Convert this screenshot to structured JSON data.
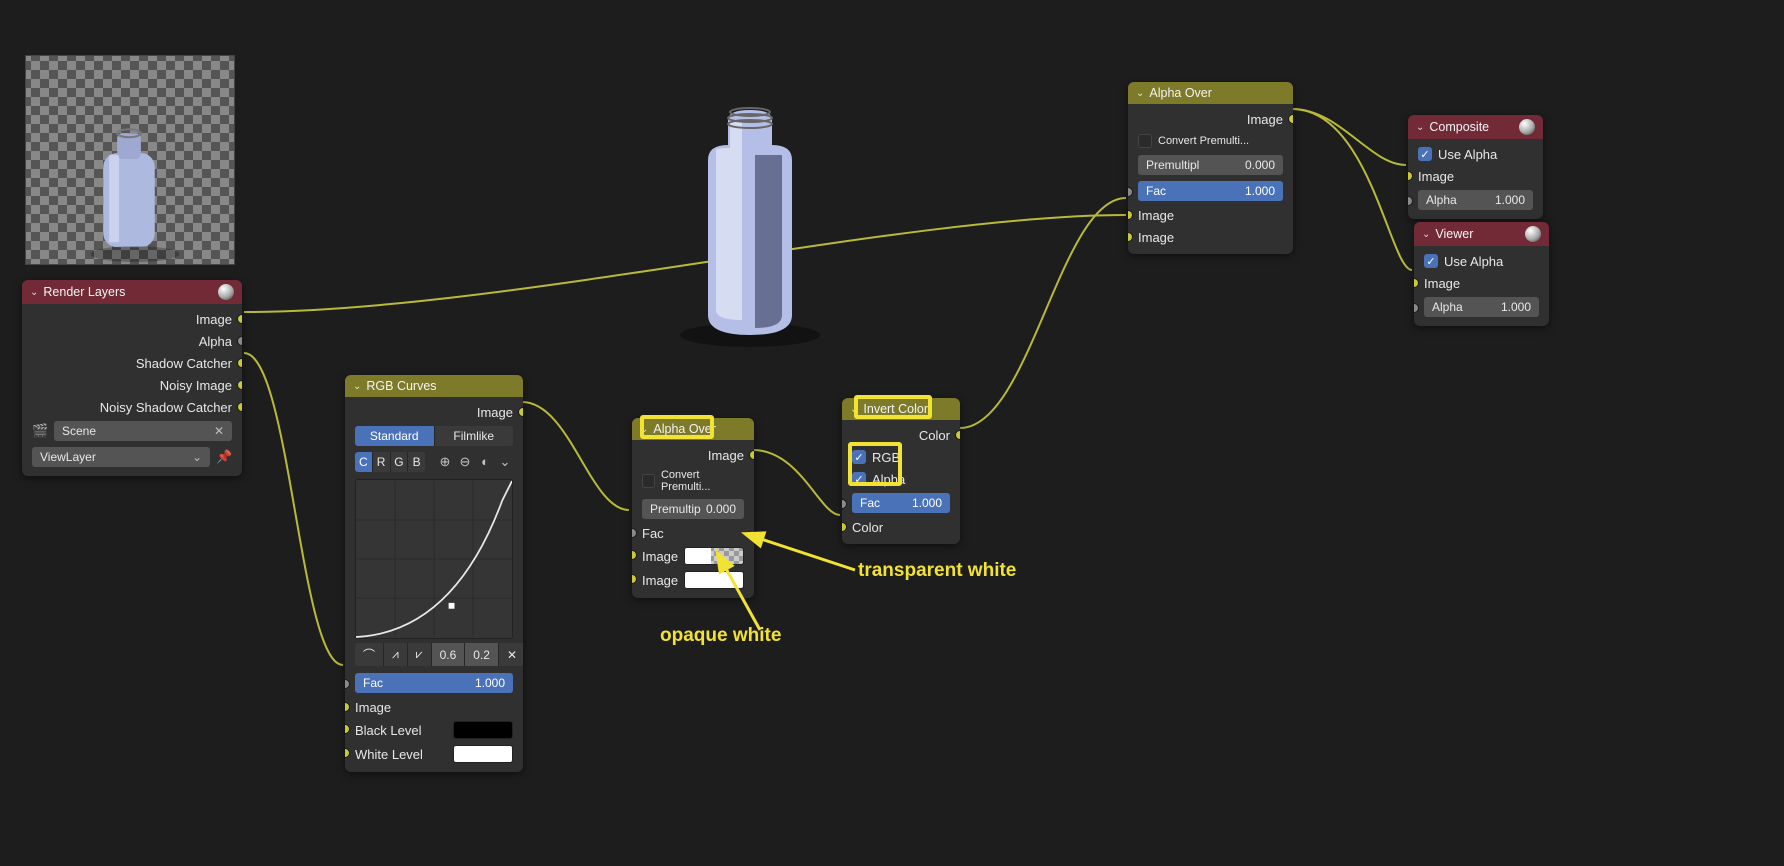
{
  "nodes": {
    "renderLayers": {
      "title": "Render Layers",
      "outputs": [
        "Image",
        "Alpha",
        "Shadow Catcher",
        "Noisy Image",
        "Noisy Shadow Catcher"
      ],
      "scene": "Scene",
      "viewLayer": "ViewLayer"
    },
    "rgbCurves": {
      "title": "RGB Curves",
      "outImage": "Image",
      "tabs": {
        "standard": "Standard",
        "filmlike": "Filmlike"
      },
      "channels": [
        "C",
        "R",
        "G",
        "B"
      ],
      "xval": "0.6",
      "yval": "0.2",
      "fac": {
        "label": "Fac",
        "value": "1.000"
      },
      "inputs": {
        "image": "Image",
        "black": "Black Level",
        "white": "White Level"
      }
    },
    "alphaOver1": {
      "title": "Alpha Over",
      "outImage": "Image",
      "convert": "Convert Premulti...",
      "premul": {
        "label": "Premultip",
        "value": "0.000"
      },
      "fac": "Fac",
      "image1": "Image",
      "image2": "Image"
    },
    "invert": {
      "title": "Invert Color",
      "outColor": "Color",
      "rgb": "RGB",
      "alpha": "Alpha",
      "fac": {
        "label": "Fac",
        "value": "1.000"
      },
      "inColor": "Color"
    },
    "alphaOver2": {
      "title": "Alpha Over",
      "outImage": "Image",
      "convert": "Convert Premulti...",
      "premul": {
        "label": "Premultipl",
        "value": "0.000"
      },
      "fac": {
        "label": "Fac",
        "value": "1.000"
      },
      "image1": "Image",
      "image2": "Image"
    },
    "composite": {
      "title": "Composite",
      "useAlpha": "Use Alpha",
      "image": "Image",
      "alpha": {
        "label": "Alpha",
        "value": "1.000"
      }
    },
    "viewer": {
      "title": "Viewer",
      "useAlpha": "Use Alpha",
      "image": "Image",
      "alpha": {
        "label": "Alpha",
        "value": "1.000"
      }
    }
  },
  "annotations": {
    "transparent": "transparent white",
    "opaque": "opaque white"
  }
}
